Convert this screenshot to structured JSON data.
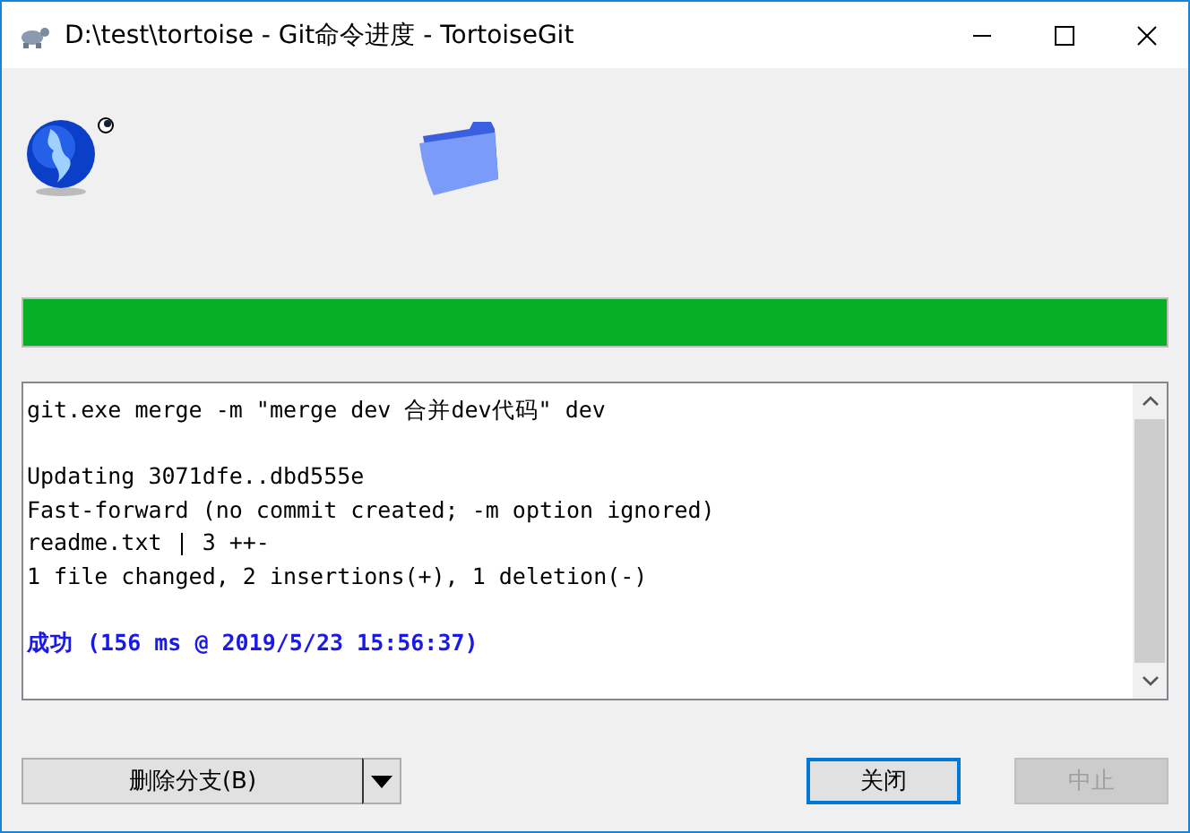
{
  "window": {
    "title": "D:\\test\\tortoise - Git命令进度 - TortoiseGit"
  },
  "progress": {
    "level": 1
  },
  "log": {
    "blocks": [
      {
        "kind": "plain",
        "lines": [
          "git.exe merge -m \"merge dev 合并dev代码\" dev"
        ]
      },
      {
        "kind": "plain",
        "lines": [
          "Updating 3071dfe..dbd555e",
          "Fast-forward (no commit created; -m option ignored)",
          "readme.txt | 3 ++-",
          "1 file changed, 2 insertions(+), 1 deletion(-)"
        ]
      },
      {
        "kind": "success",
        "lines": [
          "成功 (156 ms @ 2019/5/23 15:56:37)"
        ]
      }
    ]
  },
  "buttons": [
    {
      "kind": "split",
      "label": "删除分支(B)",
      "disabled": false,
      "default": false
    },
    {
      "kind": "push",
      "label": "关闭",
      "disabled": false,
      "default": true
    },
    {
      "kind": "push",
      "label": "中止",
      "disabled": true,
      "default": false
    }
  ]
}
